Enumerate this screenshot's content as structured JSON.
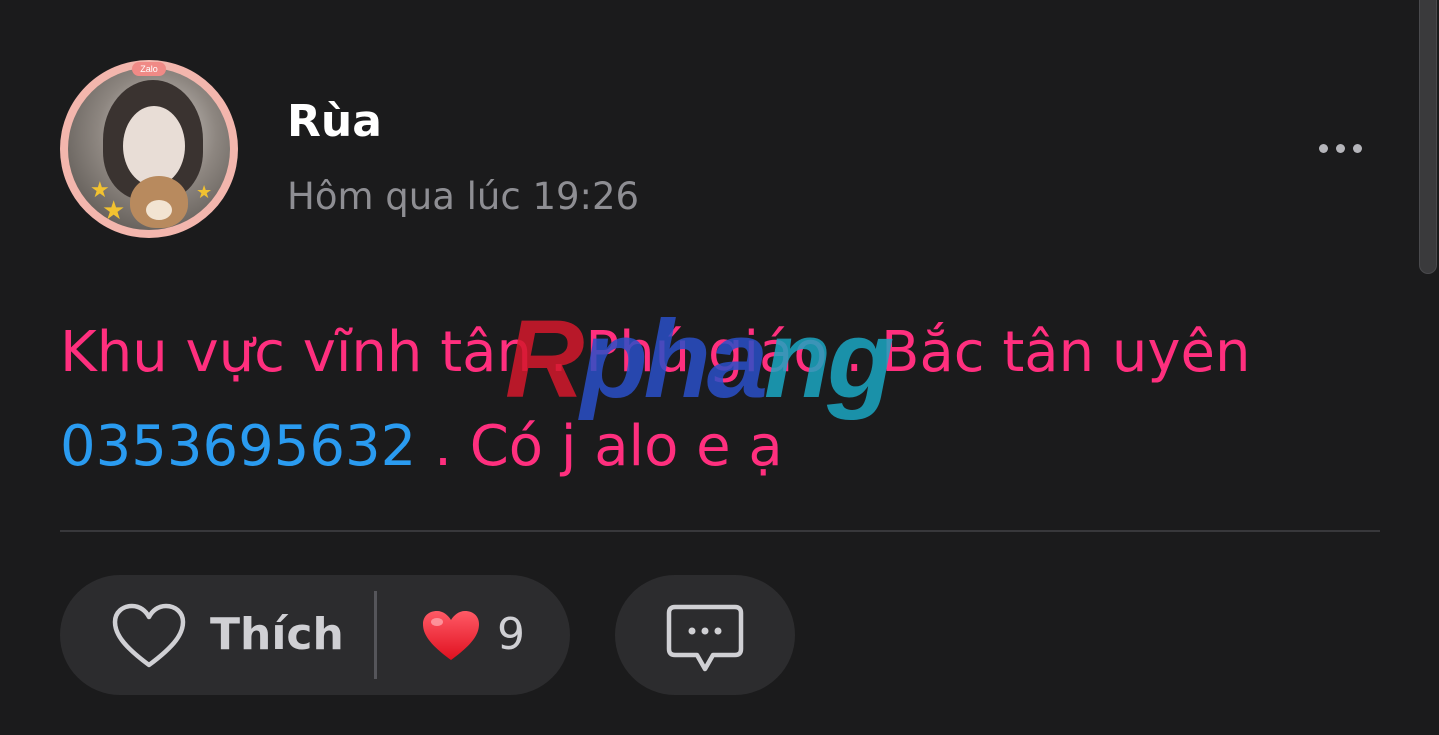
{
  "post": {
    "author_name": "Rùa",
    "timestamp": "Hôm qua lúc 19:26",
    "avatar_badge": "Zalo",
    "text_line1": "Khu vực vĩnh tân . Phú giáo . Bắc tân uyên",
    "phone": "0353695632",
    "text_line2_rest": " . Có j alo e ạ"
  },
  "watermark": {
    "part_a": "R",
    "part_b": "pha",
    "part_c": "ng"
  },
  "actions": {
    "like_label": "Thích",
    "reaction_count": "9"
  },
  "icons": {
    "more": "more-horizontal-icon",
    "like": "heart-outline-icon",
    "reaction": "heart-filled-icon",
    "comment": "comment-bubble-icon"
  },
  "colors": {
    "background": "#1b1b1c",
    "post_text": "#ff2f7e",
    "phone_link": "#2a9bf0",
    "pill_background": "#2c2c2e",
    "heart_red": "#ff2a3c"
  }
}
